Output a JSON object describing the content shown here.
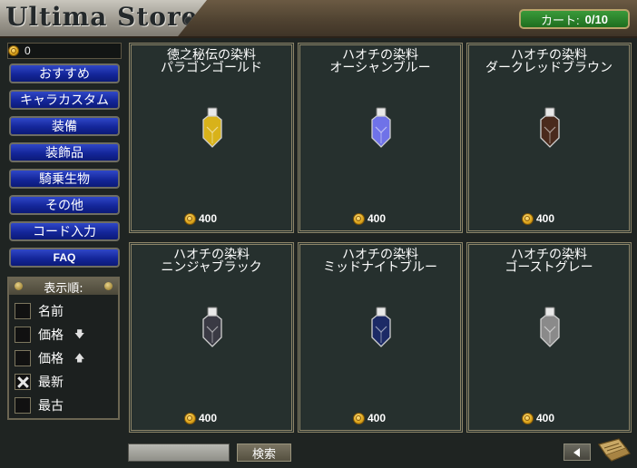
{
  "header": {
    "title": "Ultima Store",
    "cart_label": "カート:",
    "cart_count": "0/10"
  },
  "sidebar": {
    "balance": "0",
    "menu": [
      {
        "label": "おすすめ"
      },
      {
        "label": "キャラカスタム"
      },
      {
        "label": "装備"
      },
      {
        "label": "装飾品"
      },
      {
        "label": "騎乗生物"
      },
      {
        "label": "その他"
      },
      {
        "label": "コード入力"
      },
      {
        "label": "FAQ"
      }
    ],
    "sort": {
      "title": "表示順:",
      "options": [
        {
          "label": "名前",
          "checked": false,
          "arrow": ""
        },
        {
          "label": "価格",
          "checked": false,
          "arrow": "down"
        },
        {
          "label": "価格",
          "checked": false,
          "arrow": "up"
        },
        {
          "label": "最新",
          "checked": true,
          "arrow": ""
        },
        {
          "label": "最古",
          "checked": false,
          "arrow": ""
        }
      ]
    }
  },
  "products": [
    {
      "line1": "徳之秘伝の染料",
      "line2": "パラゴンゴールド",
      "price": "400",
      "color": "#d8b21a"
    },
    {
      "line1": "ハオチの染料",
      "line2": "オーシャンブルー",
      "price": "400",
      "color": "#6f72e8"
    },
    {
      "line1": "ハオチの染料",
      "line2": "ダークレッドブラウン",
      "price": "400",
      "color": "#4a2a1c"
    },
    {
      "line1": "ハオチの染料",
      "line2": "ニンジャブラック",
      "price": "400",
      "color": "#3a3a44"
    },
    {
      "line1": "ハオチの染料",
      "line2": "ミッドナイトブルー",
      "price": "400",
      "color": "#1c2a66"
    },
    {
      "line1": "ハオチの染料",
      "line2": "ゴーストグレー",
      "price": "400",
      "color": "#8a8a8a"
    }
  ],
  "footer": {
    "search_value": "",
    "search_label": "検索"
  },
  "icons": {
    "coin": "coin-icon",
    "bottle": "dye-bottle-icon",
    "prev": "arrow-left-icon",
    "scroll": "scroll-icon"
  }
}
